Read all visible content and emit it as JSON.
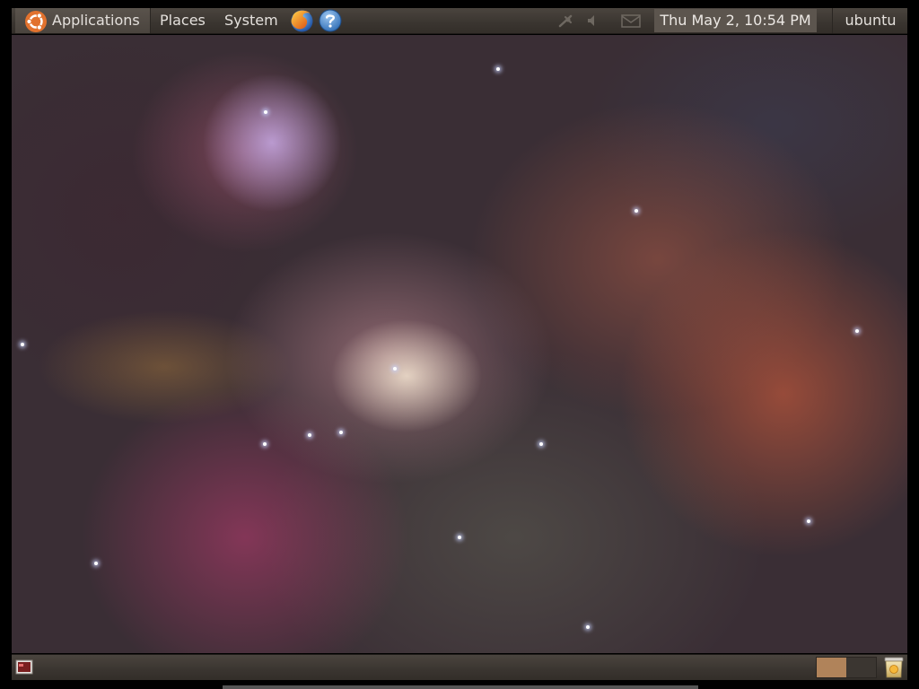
{
  "top_panel": {
    "menus": {
      "applications": "Applications",
      "places": "Places",
      "system": "System"
    },
    "launchers": [
      "firefox-icon",
      "help-icon"
    ],
    "tray_icons": [
      "network-icon",
      "volume-icon",
      "mail-icon"
    ],
    "clock": "Thu May  2, 10:54 PM",
    "user": "ubuntu"
  },
  "desktop": {
    "wallpaper": "orion-nebula"
  },
  "bottom_panel": {
    "icons": [
      "show-desktop-icon",
      "trash-icon"
    ],
    "workspaces": {
      "count": 2,
      "active": 1,
      "active_color": "#b0835a"
    }
  },
  "colors": {
    "panel": "#3a3530",
    "clock_bg": "#5c554e",
    "panel_text": "#e4e0dc",
    "ubuntu_orange": "#e2722e"
  }
}
